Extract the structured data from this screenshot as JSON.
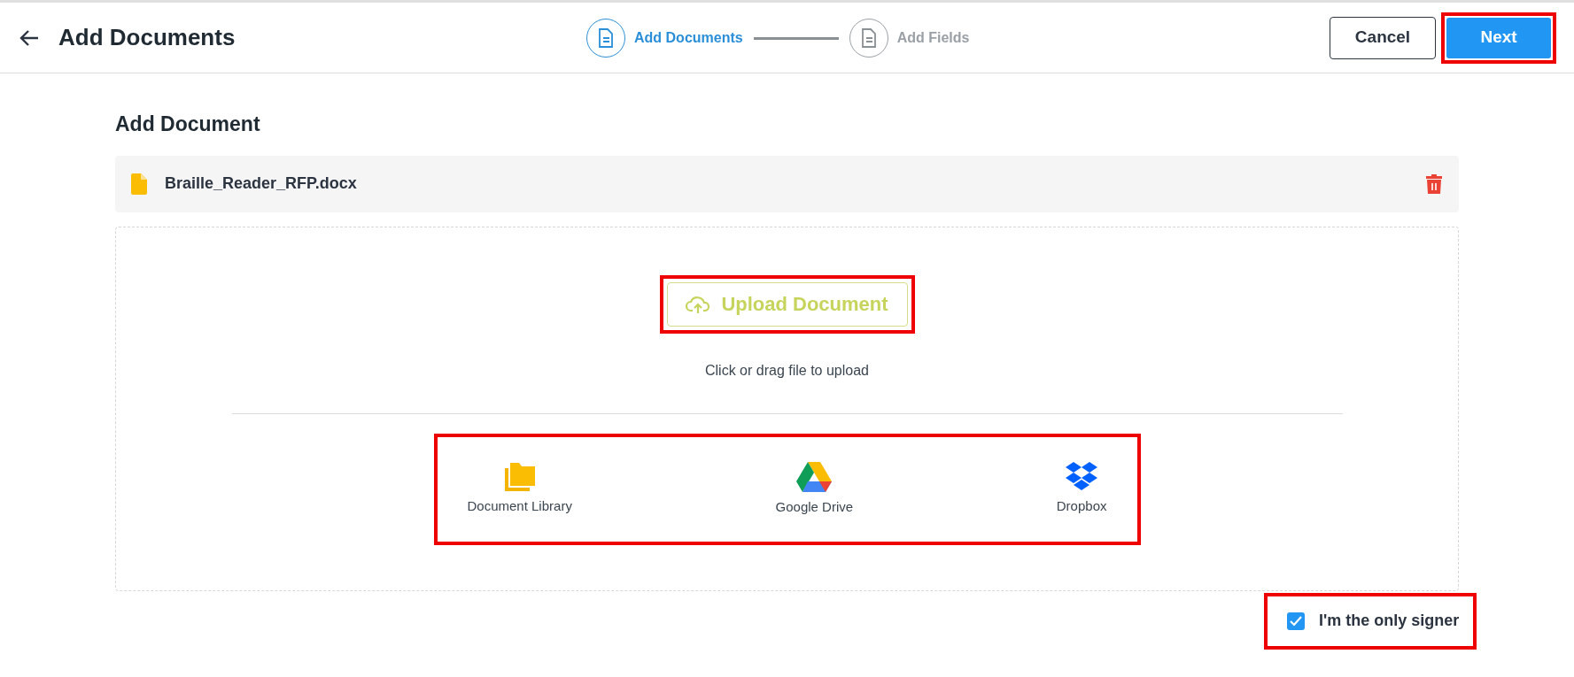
{
  "header": {
    "title": "Add Documents",
    "steps": [
      {
        "label": "Add Documents",
        "selected": true
      },
      {
        "label": "Add Fields",
        "selected": false
      }
    ],
    "cancel": "Cancel",
    "next": {
      "label": "Next",
      "highlighted": true
    }
  },
  "section_title": "Add Document",
  "file": {
    "name": "Braille_Reader_RFP.docx"
  },
  "upload": {
    "label": "Upload Document",
    "highlighted": true,
    "hint": "Click or drag file to upload"
  },
  "sources": {
    "highlighted": true,
    "items": [
      {
        "kind": "library",
        "label": "Document Library"
      },
      {
        "kind": "drive",
        "label": "Google Drive"
      },
      {
        "kind": "dropbox",
        "label": "Dropbox"
      }
    ]
  },
  "only_signer": {
    "label": "I'm the only signer",
    "checked": true,
    "highlighted": true
  }
}
